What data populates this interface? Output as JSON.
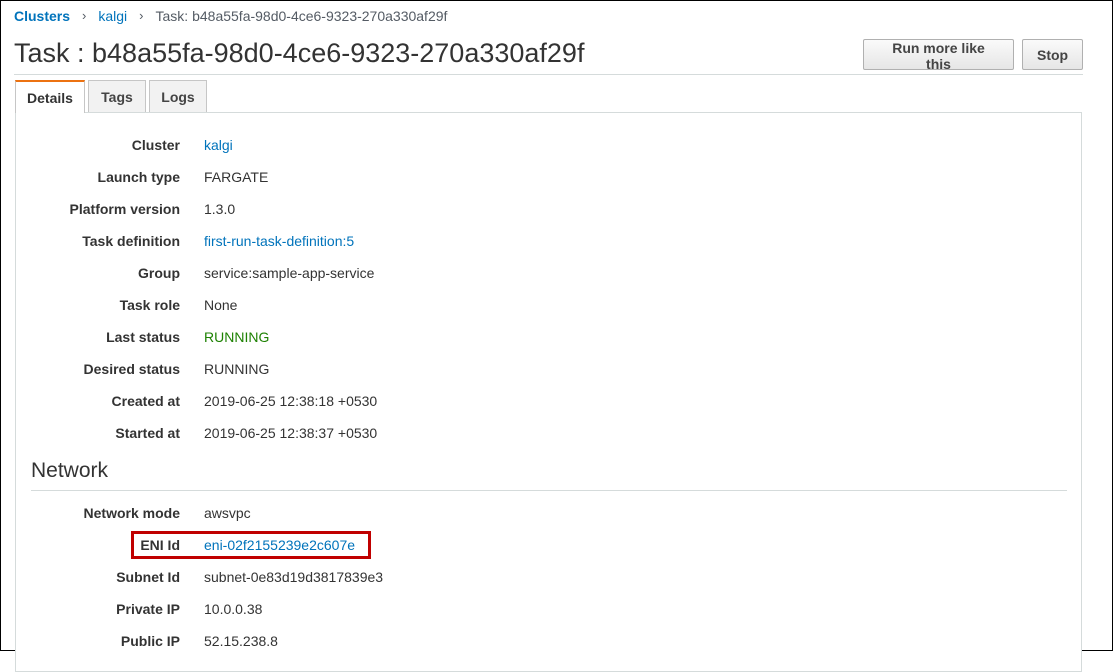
{
  "breadcrumb": {
    "clusters_label": "Clusters",
    "cluster_label": "kalgi",
    "current_label": "Task: b48a55fa-98d0-4ce6-9323-270a330af29f",
    "separator": "›"
  },
  "page": {
    "title": "Task : b48a55fa-98d0-4ce6-9323-270a330af29f"
  },
  "actions": {
    "run_more_label": "Run more like this",
    "stop_label": "Stop"
  },
  "tabs": [
    {
      "label": "Details",
      "active": true
    },
    {
      "label": "Tags",
      "active": false
    },
    {
      "label": "Logs",
      "active": false
    }
  ],
  "details": [
    {
      "label": "Cluster",
      "value": "kalgi",
      "link": true
    },
    {
      "label": "Launch type",
      "value": "FARGATE"
    },
    {
      "label": "Platform version",
      "value": "1.3.0"
    },
    {
      "label": "Task definition",
      "value": "first-run-task-definition:5",
      "link": true
    },
    {
      "label": "Group",
      "value": "service:sample-app-service"
    },
    {
      "label": "Task role",
      "value": "None"
    },
    {
      "label": "Last status",
      "value": "RUNNING",
      "status": "green"
    },
    {
      "label": "Desired status",
      "value": "RUNNING"
    },
    {
      "label": "Created at",
      "value": "2019-06-25 12:38:18 +0530"
    },
    {
      "label": "Started at",
      "value": "2019-06-25 12:38:37 +0530"
    }
  ],
  "network": {
    "section_title": "Network",
    "rows": [
      {
        "label": "Network mode",
        "value": "awsvpc"
      },
      {
        "label": "ENI Id",
        "value": "eni-02f2155239e2c607e",
        "link": true,
        "highlighted": true
      },
      {
        "label": "Subnet Id",
        "value": "subnet-0e83d19d3817839e3"
      },
      {
        "label": "Private IP",
        "value": "10.0.0.38"
      },
      {
        "label": "Public IP",
        "value": "52.15.238.8"
      }
    ]
  },
  "colors": {
    "link": "#0073bb",
    "status_running": "#1d8102",
    "active_tab_accent": "#ec7211",
    "highlight_border": "#c00000"
  }
}
